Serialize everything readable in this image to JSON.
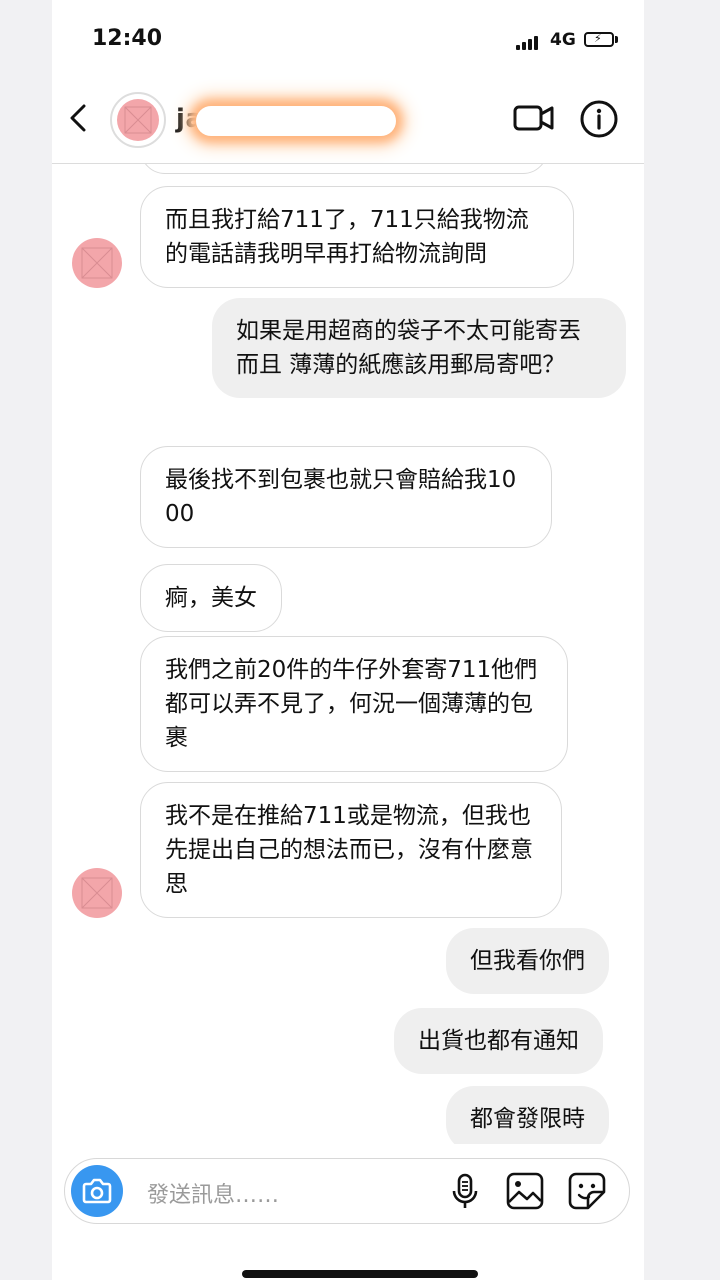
{
  "status_bar": {
    "time": "12:40",
    "network": "4G"
  },
  "header": {
    "username": "janbaby"
  },
  "messages": [
    {
      "from": "them",
      "text": "而且我打給711了，711只給我物流的電話請我明早再打給物流詢問"
    },
    {
      "from": "me",
      "text": "如果是用超商的袋子不太可能寄丟而且 薄薄的紙應該用郵局寄吧？"
    },
    {
      "from": "them",
      "text": "最後找不到包裹也就只會賠給我1000"
    },
    {
      "from": "them",
      "text": "痾，美女"
    },
    {
      "from": "them",
      "text": "我們之前20件的牛仔外套寄711他們都可以弄不見了，何況一個薄薄的包裹"
    },
    {
      "from": "them",
      "text": "我不是在推給711或是物流，但我也先提出自己的想法而已，沒有什麼意思"
    },
    {
      "from": "me",
      "text": "但我看你們"
    },
    {
      "from": "me",
      "text": "出貨也都有通知"
    },
    {
      "from": "me",
      "text": "都會發限時"
    }
  ],
  "composer": {
    "placeholder": "發送訊息……"
  },
  "colors": {
    "accent": "#3897f0",
    "avatar_pink": "#f3a6aa",
    "outgoing_bubble": "#efefef"
  },
  "icons": [
    "back-arrow-icon",
    "video-call-icon",
    "info-icon",
    "camera-icon",
    "microphone-icon",
    "gallery-icon",
    "sticker-icon"
  ]
}
